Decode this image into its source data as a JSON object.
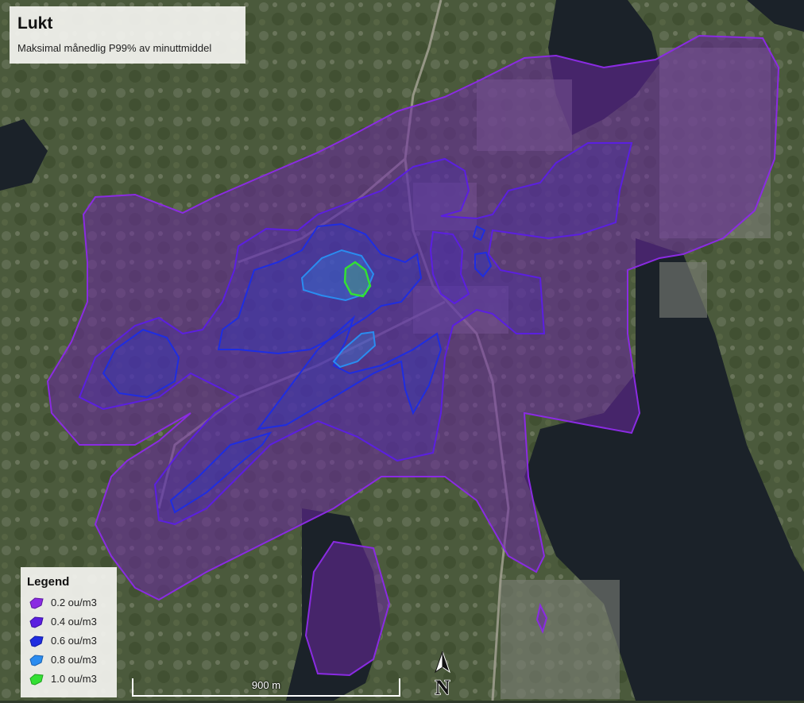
{
  "map": {
    "title": "Lukt",
    "subtitle": "Maksimal månedlig P99% av minuttmiddel"
  },
  "legend": {
    "title": "Legend",
    "items": [
      {
        "label": "0.2 ou/m3",
        "color": "#8a2be2"
      },
      {
        "label": "0.4 ou/m3",
        "color": "#5b1fe0"
      },
      {
        "label": "0.6 ou/m3",
        "color": "#1f2de0"
      },
      {
        "label": "0.8 ou/m3",
        "color": "#2a8cf0"
      },
      {
        "label": "1.0 ou/m3",
        "color": "#33e033"
      }
    ]
  },
  "scale_bar": {
    "label": "900 m"
  },
  "north_arrow": {
    "label": "N"
  }
}
